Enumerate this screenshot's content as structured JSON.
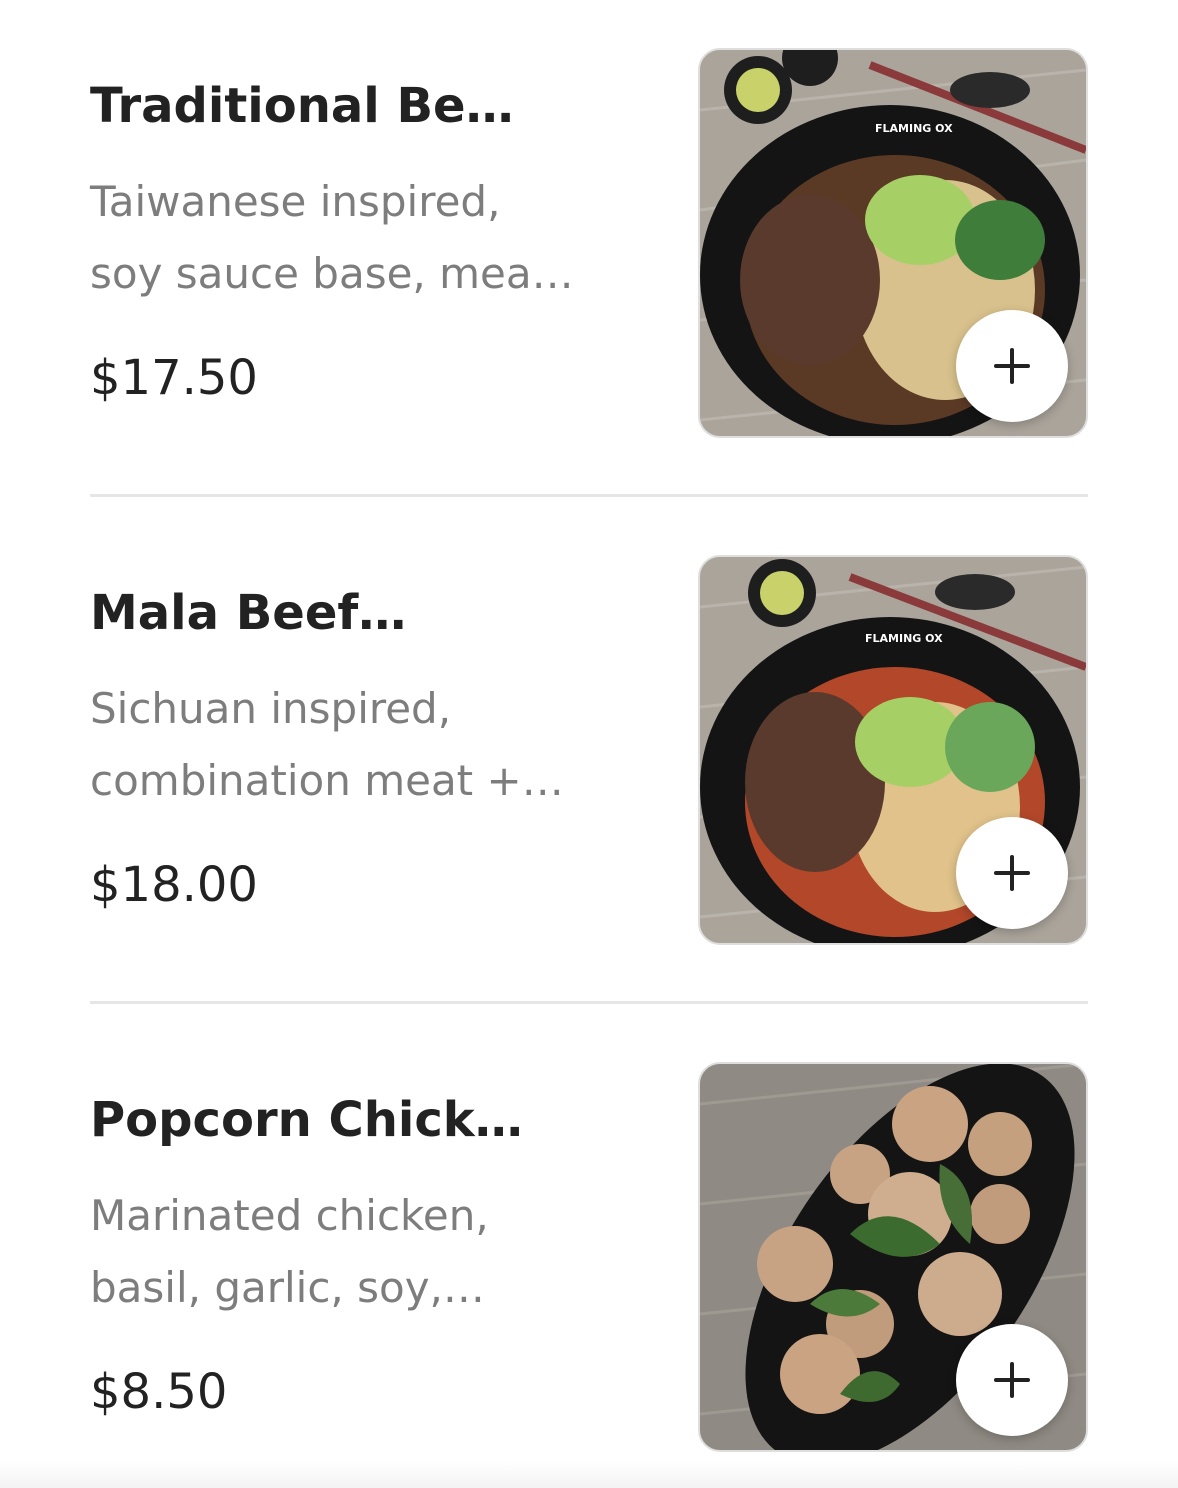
{
  "menu": {
    "items": [
      {
        "title": "Traditional Be…",
        "description_line1": "Taiwanese inspired,",
        "description_line2": "soy sauce base, mea…",
        "price": "$17.50",
        "image_icon": "beef-noodle-soup-image",
        "bowl_text": "FLAMING OX"
      },
      {
        "title": "Mala Beef…",
        "description_line1": "Sichuan inspired,",
        "description_line2": "combination meat +…",
        "price": "$18.00",
        "image_icon": "mala-beef-noodle-soup-image",
        "bowl_text": "FLAMING OX"
      },
      {
        "title": "Popcorn Chick…",
        "description_line1": "Marinated chicken,",
        "description_line2": "basil, garlic, soy,…",
        "price": "$8.50",
        "image_icon": "popcorn-chicken-image"
      }
    ],
    "add_button_icon": "plus-icon"
  },
  "colors": {
    "title": "#222222",
    "description": "#7d7d7d",
    "divider": "#e6e6e6",
    "background": "#ffffff"
  }
}
